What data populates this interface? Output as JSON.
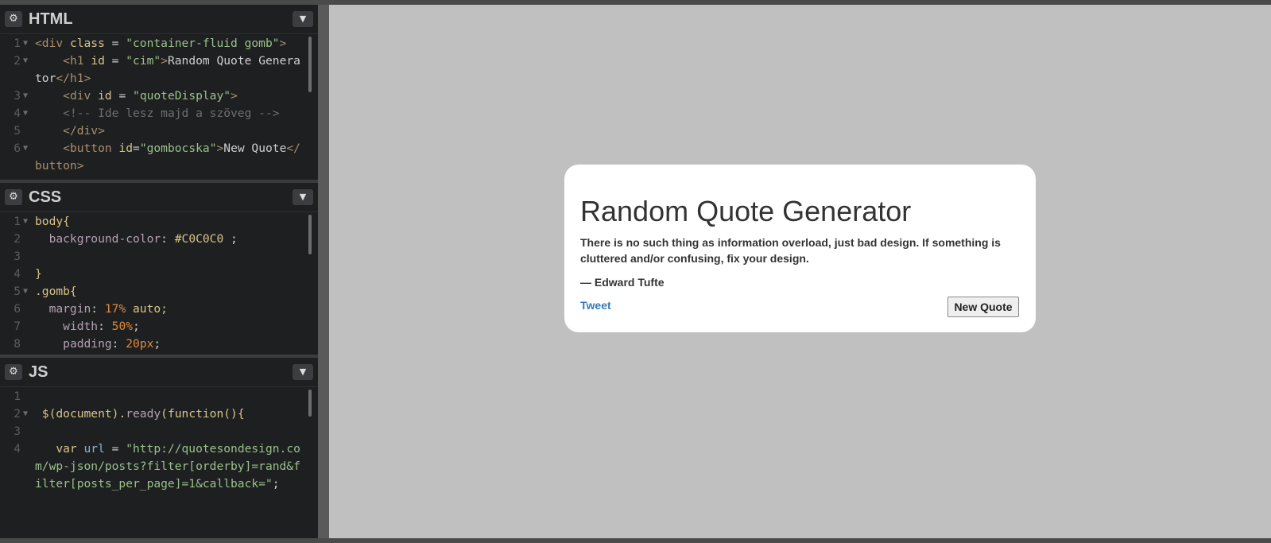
{
  "panes": {
    "html": {
      "title": "HTML",
      "lines": [
        {
          "n": "1",
          "fold": "▼"
        },
        {
          "n": "2",
          "fold": "▼"
        },
        {
          "n": "3",
          "fold": "▼"
        },
        {
          "n": "4",
          "fold": "▼"
        },
        {
          "n": "5",
          "fold": ""
        },
        {
          "n": "6",
          "fold": "▼"
        }
      ],
      "code": {
        "l1a": "<div ",
        "l1b": "class",
        "l1c": " = ",
        "l1d": "\"container-fluid gomb\"",
        "l1e": ">",
        "l2a": "    <h1 ",
        "l2b": "id",
        "l2c": " = ",
        "l2d": "\"cim\"",
        "l2e": ">",
        "l2f": "Random Quote Generator",
        "l2g": "</h1>",
        "l3a": "    <div ",
        "l3b": "id",
        "l3c": " = ",
        "l3d": "\"quoteDisplay\"",
        "l3e": ">",
        "l4": "    <!-- Ide lesz majd a szöveg -->",
        "l5": "    </div>",
        "l6a": "    <button ",
        "l6b": "id",
        "l6c": "=",
        "l6d": "\"gombocska\"",
        "l6e": ">",
        "l6f": "New Quote",
        "l6g": "</button>"
      }
    },
    "css": {
      "title": "CSS",
      "lines": [
        {
          "n": "1",
          "fold": "▼"
        },
        {
          "n": "2",
          "fold": ""
        },
        {
          "n": "3",
          "fold": ""
        },
        {
          "n": "4",
          "fold": ""
        },
        {
          "n": "5",
          "fold": "▼"
        },
        {
          "n": "6",
          "fold": ""
        },
        {
          "n": "7",
          "fold": ""
        },
        {
          "n": "8",
          "fold": ""
        }
      ],
      "code": {
        "l1": "body{",
        "l2a": "  background-color",
        "l2b": ": ",
        "l2c": "#C0C0C0",
        "l2d": " ;",
        "l3": "",
        "l4": "}",
        "l5": ".gomb{",
        "l6a": "  margin",
        "l6b": ": ",
        "l6c": "17%",
        "l6d": " auto;",
        "l7a": "    width",
        "l7b": ": ",
        "l7c": "50%",
        "l7d": ";",
        "l8a": "    padding",
        "l8b": ": ",
        "l8c": "20px",
        "l8d": ";"
      }
    },
    "js": {
      "title": "JS",
      "lines": [
        {
          "n": "1",
          "fold": ""
        },
        {
          "n": "2",
          "fold": "▼"
        },
        {
          "n": "3",
          "fold": ""
        },
        {
          "n": "4",
          "fold": ""
        }
      ],
      "code": {
        "l2a": " $(document).",
        "l2b": "ready",
        "l2c": "(",
        "l2d": "function",
        "l2e": "(){",
        "l4a": "   var ",
        "l4b": "url",
        "l4c": " = ",
        "l4d": "\"http://quotesondesign.com/wp-json/posts?filter[orderby]=rand&filter[posts_per_page]=1&callback=\"",
        "l4e": ";"
      }
    }
  },
  "icons": {
    "settings": "gear-icon",
    "collapse": "chevron-down-icon"
  },
  "preview": {
    "background": "#C0C0C0",
    "title": "Random Quote Generator",
    "quote": "There is no such thing as information overload, just bad design. If something is cluttered and/or confusing, fix your design.",
    "author": "— Edward Tufte",
    "tweet_label": "Tweet",
    "new_quote_label": "New Quote"
  }
}
